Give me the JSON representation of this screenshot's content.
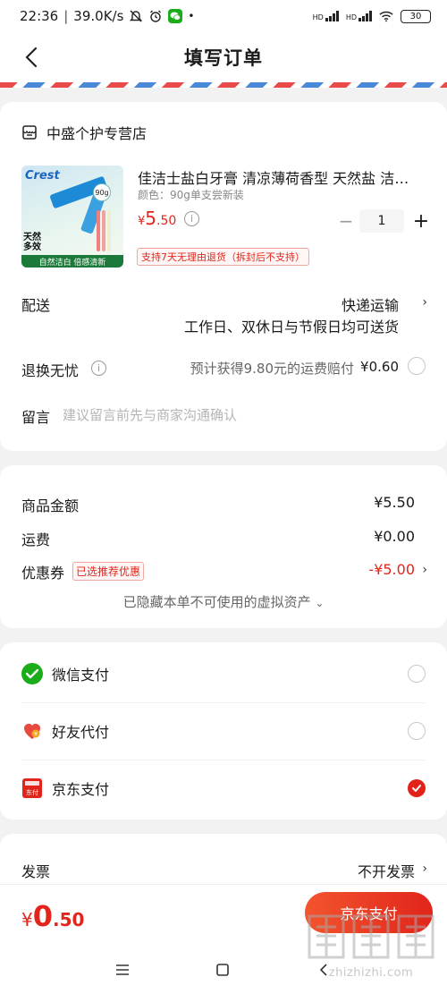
{
  "status_bar": {
    "time": "22:36",
    "speed": "39.0K/s",
    "network1": "HD",
    "network2": "HD",
    "battery": "30"
  },
  "nav": {
    "title": "填写订单"
  },
  "shop": {
    "name": "中盛个护专营店"
  },
  "product": {
    "title": "佳洁士盐白牙膏 清凉薄荷香型 天然盐 洁…",
    "spec": "颜色：90g单支尝新装",
    "price_symbol": "¥",
    "price_int": "5",
    "price_dec": ".50",
    "quantity": "1",
    "return_tag": "支持7天无理由退货（拆封后不支持）",
    "image_text": {
      "brand": "Crest",
      "weight": "90g",
      "badge": "天然\n多效",
      "slogan": "自然洁白 倍感清新"
    }
  },
  "delivery": {
    "label": "配送",
    "method": "快递运输",
    "note": "工作日、双休日与节假日均可送货"
  },
  "return_insurance": {
    "label": "退换无忧",
    "desc": "预计获得9.80元的运费赔付",
    "price": "¥0.60"
  },
  "message": {
    "label": "留言",
    "placeholder": "建议留言前先与商家沟通确认"
  },
  "summary": {
    "goods_label": "商品金额",
    "goods_value": "¥5.50",
    "shipping_label": "运费",
    "shipping_value": "¥0.00",
    "coupon_label": "优惠券",
    "coupon_tag": "已选推荐优惠",
    "coupon_value": "-¥5.00",
    "hidden_note": "已隐藏本单不可使用的虚拟资产"
  },
  "payment": {
    "options": [
      {
        "label": "微信支付",
        "selected": false
      },
      {
        "label": "好友代付",
        "selected": false
      },
      {
        "label": "京东支付",
        "selected": true
      }
    ]
  },
  "invoice": {
    "label": "发票",
    "value": "不开发票"
  },
  "bottom": {
    "total_symbol": "¥",
    "total_int": "0",
    "total_dec": ".50",
    "pay_button": "京东支付"
  },
  "watermark": {
    "text": "zhizhizhi.com"
  },
  "colors": {
    "accent": "#e1251b",
    "background": "#f2f2f2",
    "wechat": "#1aad19"
  }
}
